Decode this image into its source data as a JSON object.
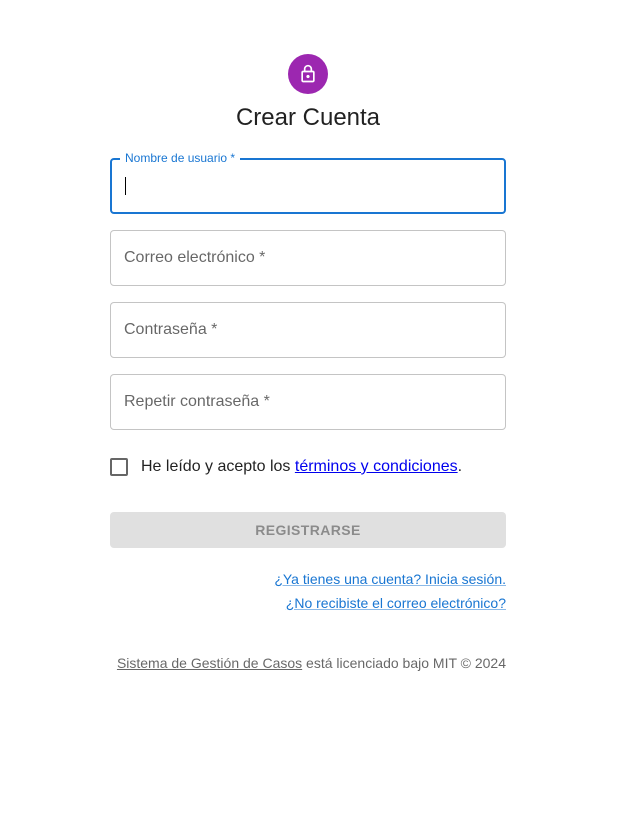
{
  "page": {
    "title": "Crear Cuenta",
    "icon": "lock-icon",
    "accent_color": "#9c27b0",
    "focus_color": "#1976d2"
  },
  "form": {
    "username": {
      "label": "Nombre de usuario *",
      "value": ""
    },
    "email": {
      "label": "Correo electrónico *",
      "value": ""
    },
    "password": {
      "label": "Contraseña *",
      "value": ""
    },
    "repeat_password": {
      "label": "Repetir contraseña *",
      "value": ""
    },
    "terms": {
      "prefix": "He leído y acepto los ",
      "link": "términos y condiciones",
      "suffix": ".",
      "checked": false
    },
    "submit_label": "REGISTRARSE",
    "submit_disabled": true
  },
  "links": {
    "login": "¿Ya tienes una cuenta? Inicia sesión.",
    "resend": "¿No recibiste el correo electrónico?"
  },
  "footer": {
    "app_name": "Sistema de Gestión de Casos",
    "license_text": " está licenciado bajo MIT © 2024"
  }
}
